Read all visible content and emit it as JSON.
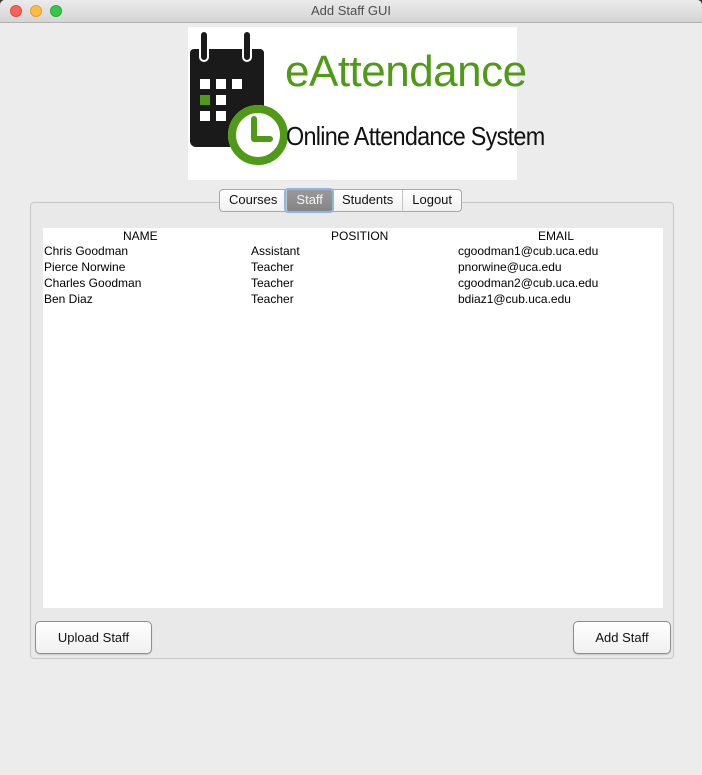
{
  "window": {
    "title": "Add Staff GUI"
  },
  "logo": {
    "title": "eAttendance",
    "subtitle": "Online Attendance System"
  },
  "tabs": [
    {
      "label": "Courses",
      "selected": false
    },
    {
      "label": "Staff",
      "selected": true
    },
    {
      "label": "Students",
      "selected": false
    },
    {
      "label": "Logout",
      "selected": false
    }
  ],
  "table": {
    "columns": [
      "NAME",
      "POSITION",
      "EMAIL"
    ],
    "rows": [
      [
        "Chris Goodman",
        "Assistant",
        "cgoodman1@cub.uca.edu"
      ],
      [
        "Pierce Norwine",
        "Teacher",
        "pnorwine@uca.edu"
      ],
      [
        "Charles Goodman",
        "Teacher",
        "cgoodman2@cub.uca.edu"
      ],
      [
        "Ben Diaz",
        "Teacher",
        "bdiaz1@cub.uca.edu"
      ]
    ]
  },
  "buttons": {
    "upload": "Upload Staff",
    "add": "Add Staff"
  },
  "colors": {
    "brand_green": "#4f9a17",
    "tab_selected": "#8a8a8a",
    "focus_ring": "#8fb5e8"
  },
  "icons": [
    "calendar-clock-icon"
  ]
}
